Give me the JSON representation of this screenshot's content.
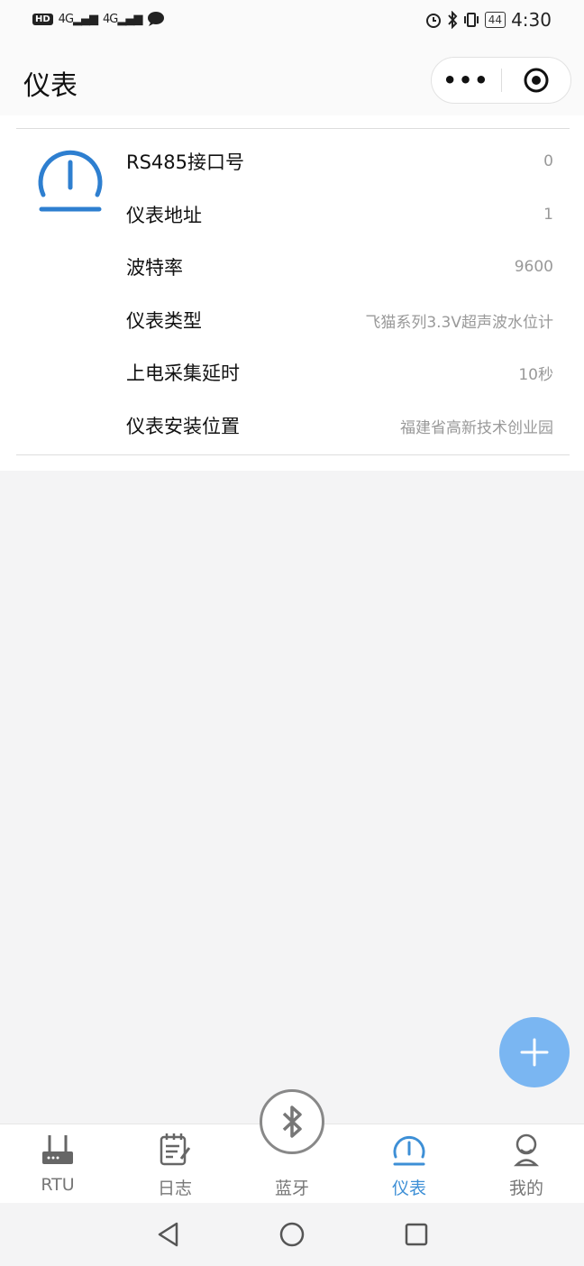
{
  "status_bar": {
    "hd": "HD",
    "sim1": "4G",
    "sim2": "4G",
    "battery": "44",
    "time": "4:30"
  },
  "header": {
    "title": "仪表",
    "more_label": "•••"
  },
  "meter": {
    "rows": [
      {
        "label": "RS485接口号",
        "value": "0"
      },
      {
        "label": "仪表地址",
        "value": "1"
      },
      {
        "label": "波特率",
        "value": "9600"
      },
      {
        "label": "仪表类型",
        "value": "飞猫系列3.3V超声波水位计"
      },
      {
        "label": "上电采集延时",
        "value": "10秒"
      },
      {
        "label": "仪表安装位置",
        "value": "福建省高新技术创业园"
      }
    ]
  },
  "fab": {
    "label": "+"
  },
  "tabbar": {
    "tabs": [
      {
        "label": "RTU",
        "icon": "router-icon"
      },
      {
        "label": "日志",
        "icon": "log-icon"
      },
      {
        "label": "蓝牙",
        "icon": "bluetooth-icon"
      },
      {
        "label": "仪表",
        "icon": "meter-icon",
        "active": true
      },
      {
        "label": "我的",
        "icon": "profile-icon"
      }
    ]
  },
  "colors": {
    "accent": "#3d8fd6",
    "fab": "#7ab6f2",
    "inactive": "#777777"
  }
}
